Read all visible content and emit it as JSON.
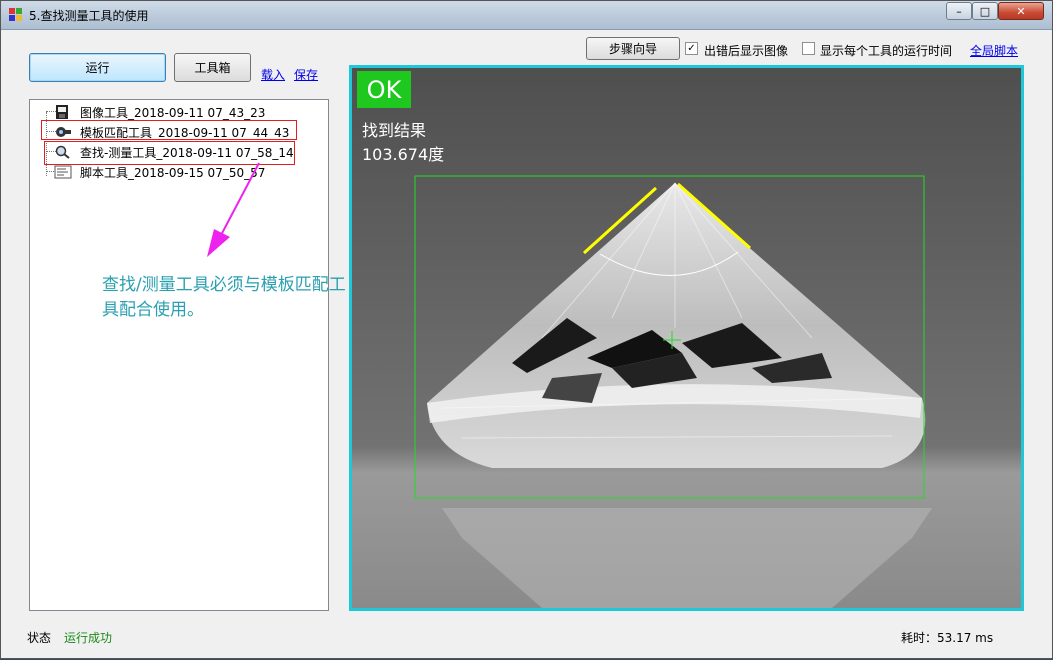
{
  "window": {
    "title": "5.查找测量工具的使用",
    "minimize": "–",
    "maximize": "□",
    "close": "✕"
  },
  "toolbar": {
    "run_label": "运行",
    "toolbox_label": "工具箱",
    "load_label": "载入",
    "save_label": "保存",
    "wizard_label": "步骤向导",
    "show_image_on_error": {
      "label": "出错后显示图像",
      "checked": true
    },
    "show_tool_time": {
      "label": "显示每个工具的运行时间",
      "checked": false
    },
    "global_script_label": "全局脚本"
  },
  "tree": {
    "items": [
      {
        "label": "图像工具_2018-09-11 07_43_23",
        "icon": "image-tool-icon"
      },
      {
        "label": "模板匹配工具_2018-09-11 07_44_43",
        "icon": "template-match-icon"
      },
      {
        "label": "查找-测量工具_2018-09-11 07_58_14",
        "icon": "find-measure-icon"
      },
      {
        "label": "脚本工具_2018-09-15 07_50_57",
        "icon": "script-tool-icon"
      }
    ]
  },
  "annotation": {
    "text": "查找/测量工具必须与模板匹配工具配合使用。",
    "arrow_color": "#ee22ee"
  },
  "viewer": {
    "status": "OK",
    "result_line1": "找到结果",
    "result_line2": "103.674度",
    "border_color": "#1fc8d8",
    "roi_color": "#22dd22",
    "edge_color": "#ffff00"
  },
  "statusbar": {
    "status_label": "状态",
    "status_value": "运行成功",
    "time_text": "耗时：53.17 ms"
  }
}
